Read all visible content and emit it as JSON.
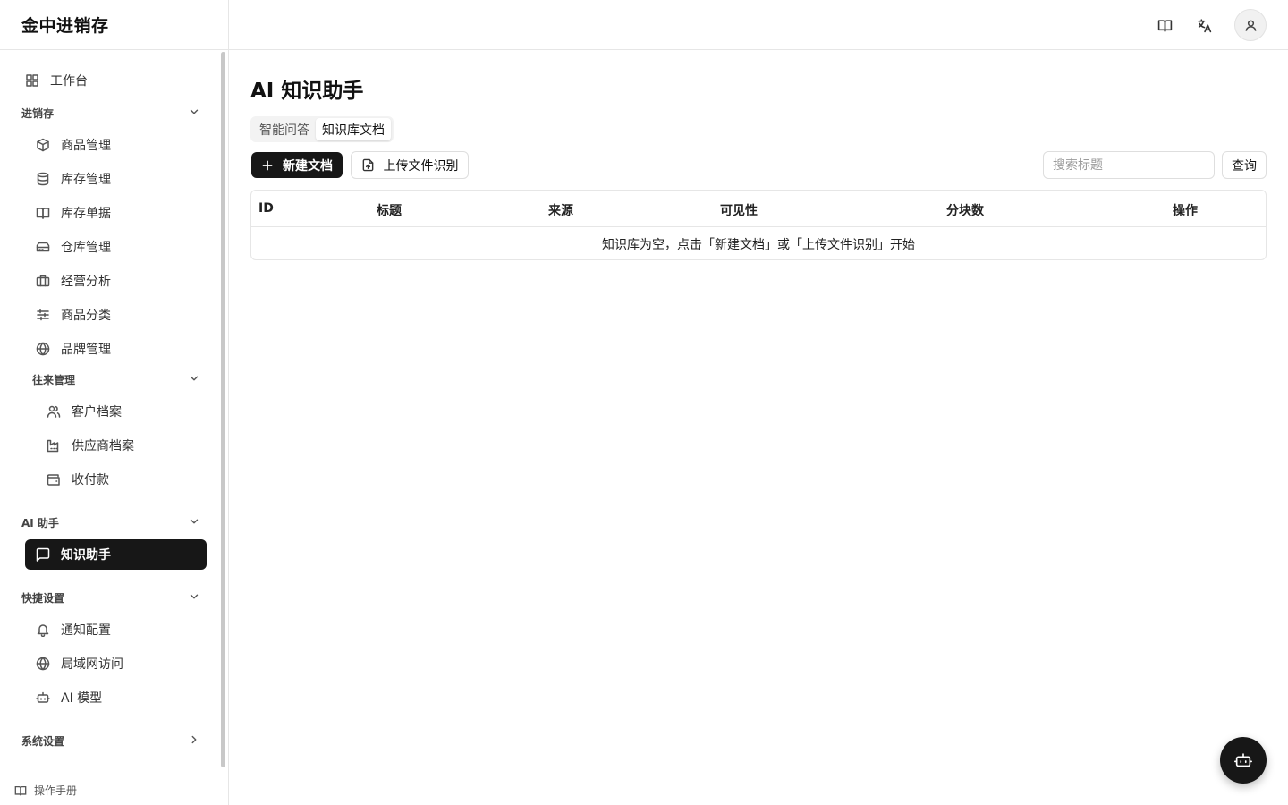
{
  "app": {
    "brand": "金中进销存"
  },
  "sidebar": {
    "workbench": "工作台",
    "groups": {
      "jxc": "进销存",
      "wanglai": "往来管理",
      "ai": "AI 助手",
      "quick": "快捷设置",
      "system": "系统设置"
    },
    "items": {
      "products": "商品管理",
      "inventory": "库存管理",
      "stock_docs": "库存单据",
      "warehouse": "仓库管理",
      "analysis": "经营分析",
      "category": "商品分类",
      "brand": "品牌管理",
      "customers": "客户档案",
      "suppliers": "供应商档案",
      "payments": "收付款",
      "knowledge": "知识助手",
      "notify": "通知配置",
      "lan": "局域网访问",
      "ai_model": "AI 模型"
    },
    "footer": "操作手册"
  },
  "main": {
    "title": "AI 知识助手",
    "tabs": [
      "智能问答",
      "知识库文档"
    ],
    "active_tab": "知识库文档",
    "new_doc_label": "新建文档",
    "upload_label": "上传文件识别",
    "search_placeholder": "搜索标题",
    "query_label": "查询",
    "table": {
      "columns": [
        "ID",
        "标题",
        "来源",
        "可见性",
        "分块数",
        "操作"
      ],
      "empty_text": "知识库为空，点击「新建文档」或「上传文件识别」开始"
    }
  },
  "icons": {
    "topbar": [
      "book-icon",
      "translate-icon",
      "user-icon"
    ],
    "fab": "bot-icon"
  },
  "colors": {
    "primary": "#171717",
    "border": "#e6e6e6"
  }
}
